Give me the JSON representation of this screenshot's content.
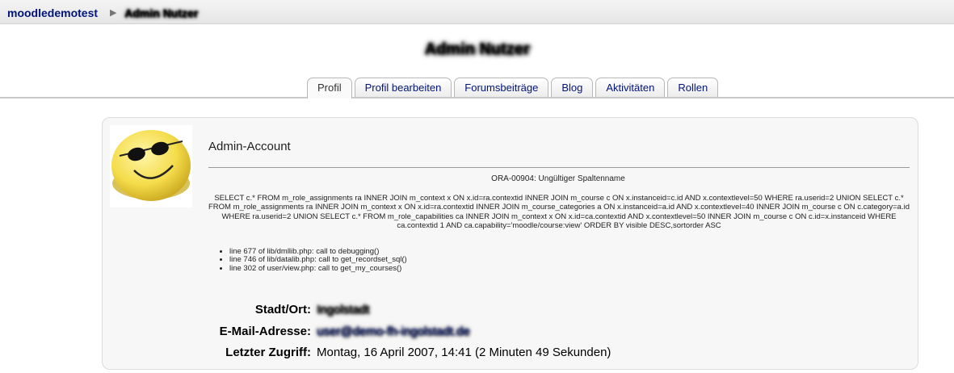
{
  "breadcrumb": {
    "site": "moodledemotest",
    "separator": "▶",
    "current": "Admin Nutzer"
  },
  "page_title": "Admin Nutzer",
  "tabs": [
    {
      "label": "Profil",
      "active": true
    },
    {
      "label": "Profil bearbeiten",
      "active": false
    },
    {
      "label": "Forumsbeiträge",
      "active": false
    },
    {
      "label": "Blog",
      "active": false
    },
    {
      "label": "Aktivitäten",
      "active": false
    },
    {
      "label": "Rollen",
      "active": false
    }
  ],
  "profile": {
    "name": "Admin-Account",
    "avatar_icon": "smiley-sunglasses-icon"
  },
  "error": {
    "title": "ORA-00904: Ungültiger Spaltenname",
    "sql": "SELECT c.* FROM m_role_assignments ra INNER JOIN m_context x ON x.id=ra.contextid INNER JOIN m_course c ON x.instanceid=c.id AND x.contextlevel=50 WHERE ra.userid=2 UNION SELECT c.* FROM m_role_assignments ra INNER JOIN m_context x ON x.id=ra.contextid INNER JOIN m_course_categories a ON x.instanceid=a.id AND x.contextlevel=40 INNER JOIN m_course c ON c.category=a.id WHERE ra.userid=2 UNION SELECT c.* FROM m_role_capabilities ca INNER JOIN m_context x ON x.id=ca.contextid AND x.contextlevel=50 INNER JOIN m_course c ON c.id=x.instanceid WHERE ca.contextid 1 AND ca.capability='moodle/course:view' ORDER BY visible DESC,sortorder ASC",
    "trace": [
      "line 677 of lib/dmllib.php: call to debugging()",
      "line 746 of lib/datalib.php: call to get_recordset_sql()",
      "line 302 of user/view.php: call to get_my_courses()"
    ]
  },
  "fields": {
    "city_label": "Stadt/Ort:",
    "city_value": "Ingolstadt",
    "email_label": "E-Mail-Adresse:",
    "email_value": "user@demo-fh-ingolstadt.de",
    "lastaccess_label": "Letzter Zugriff:",
    "lastaccess_value": "Montag, 16 April 2007, 14:41  (2 Minuten 49 Sekunden)"
  },
  "colors": {
    "link": "#00147a",
    "box_bg": "#f7f7f7",
    "smiley": "#f4dc4a"
  }
}
